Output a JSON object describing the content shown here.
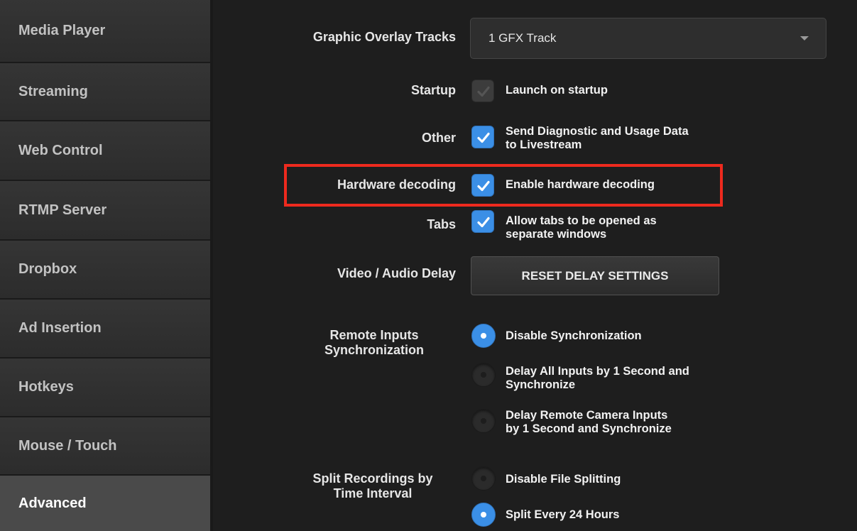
{
  "sidebar": {
    "items": [
      {
        "label": "Media Player"
      },
      {
        "label": "Streaming"
      },
      {
        "label": "Web Control"
      },
      {
        "label": "RTMP Server"
      },
      {
        "label": "Dropbox"
      },
      {
        "label": "Ad Insertion"
      },
      {
        "label": "Hotkeys"
      },
      {
        "label": "Mouse / Touch"
      },
      {
        "label": "Advanced"
      }
    ],
    "active": "Advanced"
  },
  "settings": {
    "graphic_overlay": {
      "label": "Graphic Overlay Tracks",
      "value": "1 GFX Track"
    },
    "startup": {
      "label": "Startup",
      "option": "Launch on startup",
      "checked": true,
      "disabled": true
    },
    "other": {
      "label": "Other",
      "option_line1": "Send Diagnostic and Usage Data",
      "option_line2": "to Livestream",
      "checked": true
    },
    "hardware_decoding": {
      "label": "Hardware decoding",
      "option": "Enable hardware decoding",
      "checked": true
    },
    "tabs": {
      "label": "Tabs",
      "option_line1": "Allow tabs to be opened as",
      "option_line2": "separate windows",
      "checked": true
    },
    "delay": {
      "label": "Video / Audio Delay",
      "button": "RESET DELAY SETTINGS"
    },
    "remote_sync": {
      "label_line1": "Remote Inputs",
      "label_line2": "Synchronization",
      "options": [
        {
          "line1": "Disable Synchronization",
          "line2": "",
          "selected": true
        },
        {
          "line1": "Delay All Inputs by 1 Second and",
          "line2": "Synchronize",
          "selected": false
        },
        {
          "line1": "Delay Remote Camera Inputs",
          "line2": "by 1 Second and Synchronize",
          "selected": false
        }
      ]
    },
    "split_recordings": {
      "label_line1": "Split Recordings by",
      "label_line2": "Time Interval",
      "options": [
        {
          "line1": "Disable File Splitting",
          "selected": false
        },
        {
          "line1": "Split Every 24 Hours",
          "selected": true
        }
      ]
    }
  },
  "colors": {
    "accent": "#3b8fe6",
    "highlight": "#ee2a1e"
  }
}
